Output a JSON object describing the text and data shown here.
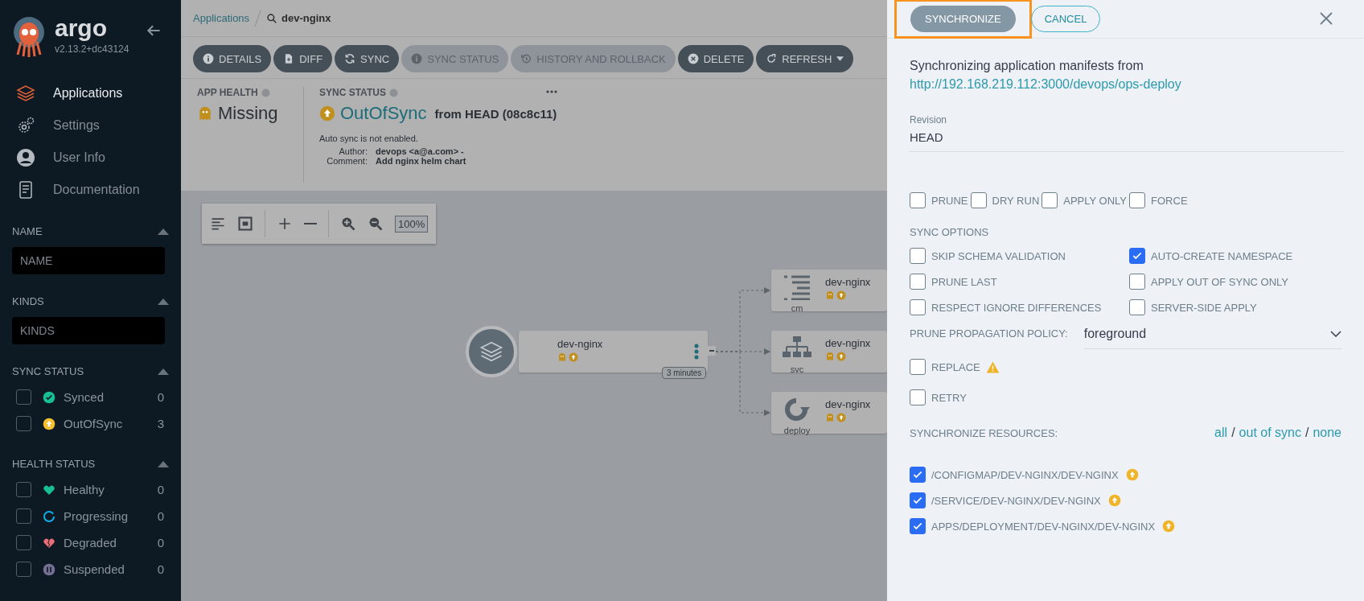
{
  "sidebar": {
    "logo": "argo",
    "version": "v2.13.2+dc43124",
    "nav": [
      {
        "label": "Applications",
        "selected": true
      },
      {
        "label": "Settings",
        "selected": false
      },
      {
        "label": "User Info",
        "selected": false
      },
      {
        "label": "Documentation",
        "selected": false
      }
    ],
    "filters": [
      {
        "kind": "text",
        "title": "NAME",
        "placeholder": "NAME"
      },
      {
        "kind": "text",
        "title": "KINDS",
        "placeholder": "KINDS"
      },
      {
        "kind": "checklist",
        "title": "SYNC STATUS",
        "items": [
          {
            "label": "Synced",
            "count": "0",
            "checked": false,
            "color": "#18be94"
          },
          {
            "label": "OutOfSync",
            "count": "3",
            "checked": false,
            "color": "#f4c030"
          }
        ]
      },
      {
        "kind": "checklist",
        "title": "HEALTH STATUS",
        "items": [
          {
            "label": "Healthy",
            "count": "0",
            "checked": false,
            "color": "#18be94"
          },
          {
            "label": "Progressing",
            "count": "0",
            "checked": false,
            "color": "#0dadea"
          },
          {
            "label": "Degraded",
            "count": "0",
            "checked": false,
            "color": "#e96d76"
          },
          {
            "label": "Suspended",
            "count": "0",
            "checked": false,
            "color": "#766f94"
          }
        ]
      }
    ]
  },
  "breadcrumb": {
    "parent": "Applications",
    "current": "dev-nginx"
  },
  "actions": [
    {
      "label": "DETAILS",
      "disabled": false
    },
    {
      "label": "DIFF",
      "disabled": false
    },
    {
      "label": "SYNC",
      "disabled": false
    },
    {
      "label": "SYNC STATUS",
      "disabled": true
    },
    {
      "label": "HISTORY AND ROLLBACK",
      "disabled": true
    },
    {
      "label": "DELETE",
      "disabled": false
    },
    {
      "label": "REFRESH",
      "disabled": false
    }
  ],
  "app_health": {
    "title": "APP HEALTH",
    "value": "Missing"
  },
  "sync_status": {
    "title": "SYNC STATUS",
    "value": "OutOfSync",
    "revision": "from HEAD (08c8c11)",
    "note": "Auto sync is not enabled.",
    "details": [
      {
        "label": "Author:",
        "value": "devops <a@a.com> -"
      },
      {
        "label": "Comment:",
        "value": "Add nginx helm chart"
      }
    ]
  },
  "graph": {
    "zoom": "100%",
    "root": {
      "name": "dev-nginx",
      "age": "3 minutes"
    },
    "children": [
      {
        "name": "dev-nginx",
        "kind_label": "cm"
      },
      {
        "name": "dev-nginx",
        "kind_label": "svc"
      },
      {
        "name": "dev-nginx",
        "kind_label": "deploy"
      }
    ]
  },
  "panel": {
    "buttons": [
      {
        "label": "SYNCHRONIZE",
        "highlighted": true
      },
      {
        "label": "CANCEL",
        "highlighted": false
      }
    ],
    "intro": "Synchronizing application manifests from",
    "repo_url": "http://192.168.219.112:3000/devops/ops-deploy",
    "revision": {
      "label": "Revision",
      "value": "HEAD"
    },
    "options": [
      {
        "label": "PRUNE",
        "checked": false
      },
      {
        "label": "DRY RUN",
        "checked": false
      },
      {
        "label": "APPLY ONLY",
        "checked": false
      },
      {
        "label": "FORCE",
        "checked": false
      }
    ],
    "sync_options_title": "SYNC OPTIONS",
    "sync_options": [
      {
        "label": "SKIP SCHEMA VALIDATION",
        "checked": false
      },
      {
        "label": "AUTO-CREATE NAMESPACE",
        "checked": true
      },
      {
        "label": "PRUNE LAST",
        "checked": false
      },
      {
        "label": "APPLY OUT OF SYNC ONLY",
        "checked": false
      },
      {
        "label": "RESPECT IGNORE DIFFERENCES",
        "checked": false
      },
      {
        "label": "SERVER-SIDE APPLY",
        "checked": false
      }
    ],
    "prune_policy": {
      "label": "PRUNE PROPAGATION POLICY:",
      "value": "foreground"
    },
    "replace": {
      "label": "REPLACE",
      "checked": false
    },
    "retry": {
      "label": "RETRY",
      "checked": false
    },
    "resources_title": "SYNCHRONIZE RESOURCES:",
    "selectors": [
      "all",
      "out of sync",
      "none"
    ],
    "selector_separator": "/",
    "resources": [
      {
        "label": "/CONFIGMAP/DEV-NGINX/DEV-NGINX",
        "checked": true
      },
      {
        "label": "/SERVICE/DEV-NGINX/DEV-NGINX",
        "checked": true
      },
      {
        "label": "APPS/DEPLOYMENT/DEV-NGINX/DEV-NGINX",
        "checked": true
      }
    ]
  }
}
